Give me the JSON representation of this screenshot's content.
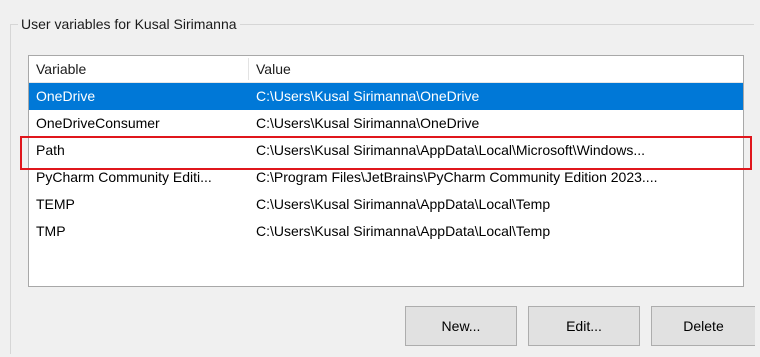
{
  "group": {
    "title": "User variables for Kusal Sirimanna"
  },
  "table": {
    "columns": {
      "variable": "Variable",
      "value": "Value"
    },
    "rows": [
      {
        "variable": "OneDrive",
        "value": "C:\\Users\\Kusal Sirimanna\\OneDrive",
        "selected": true
      },
      {
        "variable": "OneDriveConsumer",
        "value": "C:\\Users\\Kusal Sirimanna\\OneDrive",
        "selected": false
      },
      {
        "variable": "Path",
        "value": "C:\\Users\\Kusal Sirimanna\\AppData\\Local\\Microsoft\\Windows...",
        "selected": false
      },
      {
        "variable": "PyCharm Community Editi...",
        "value": "C:\\Program Files\\JetBrains\\PyCharm Community Edition 2023....",
        "selected": false
      },
      {
        "variable": "TEMP",
        "value": "C:\\Users\\Kusal Sirimanna\\AppData\\Local\\Temp",
        "selected": false
      },
      {
        "variable": "TMP",
        "value": "C:\\Users\\Kusal Sirimanna\\AppData\\Local\\Temp",
        "selected": false
      }
    ]
  },
  "buttons": {
    "new": "New...",
    "edit": "Edit...",
    "delete": "Delete"
  },
  "colors": {
    "selection": "#0078d7",
    "annotation": "#e0161c"
  }
}
